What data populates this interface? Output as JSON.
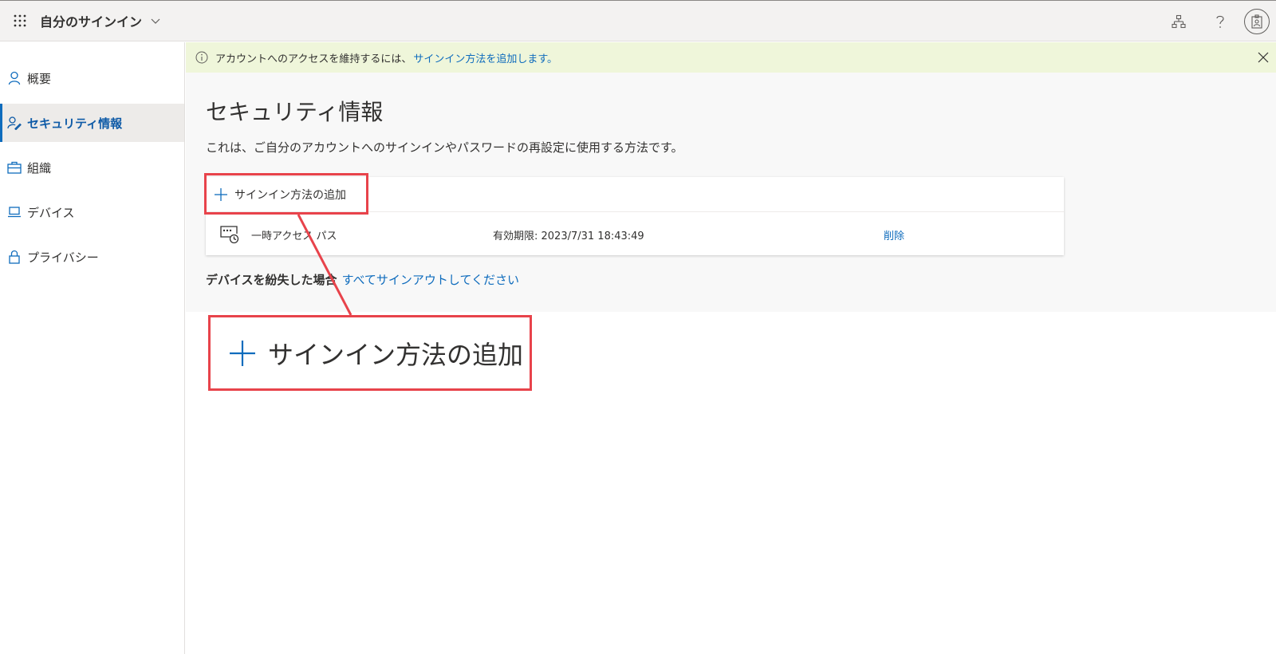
{
  "topbar": {
    "app_title": "自分のサインイン"
  },
  "sidebar": {
    "items": [
      {
        "label": "概要",
        "icon": "person-icon"
      },
      {
        "label": "セキュリティ情報",
        "icon": "security-info-icon",
        "active": true
      },
      {
        "label": "組織",
        "icon": "briefcase-icon"
      },
      {
        "label": "デバイス",
        "icon": "laptop-icon"
      },
      {
        "label": "プライバシー",
        "icon": "lock-icon"
      }
    ]
  },
  "banner": {
    "text": "アカウントへのアクセスを維持するには、",
    "link": "サインイン方法を追加します。"
  },
  "main": {
    "title": "セキュリティ情報",
    "description": "これは、ご自分のアカウントへのサインインやパスワードの再設定に使用する方法です。",
    "add_method_label": "サインイン方法の追加",
    "methods": [
      {
        "name": "一時アクセス パス",
        "expiry": "有効期限: 2023/7/31 18:43:49",
        "delete_label": "削除"
      }
    ],
    "lost_device_label": "デバイスを紛失した場合",
    "sign_out_link": "すべてサインアウトしてください"
  },
  "annotation": {
    "zoom_label": "サインイン方法の追加",
    "highlight_color": "#e8434b"
  },
  "colors": {
    "accent": "#0f6cbd",
    "banner_bg": "#eff6da",
    "topbar_bg": "#f3f2f1"
  }
}
